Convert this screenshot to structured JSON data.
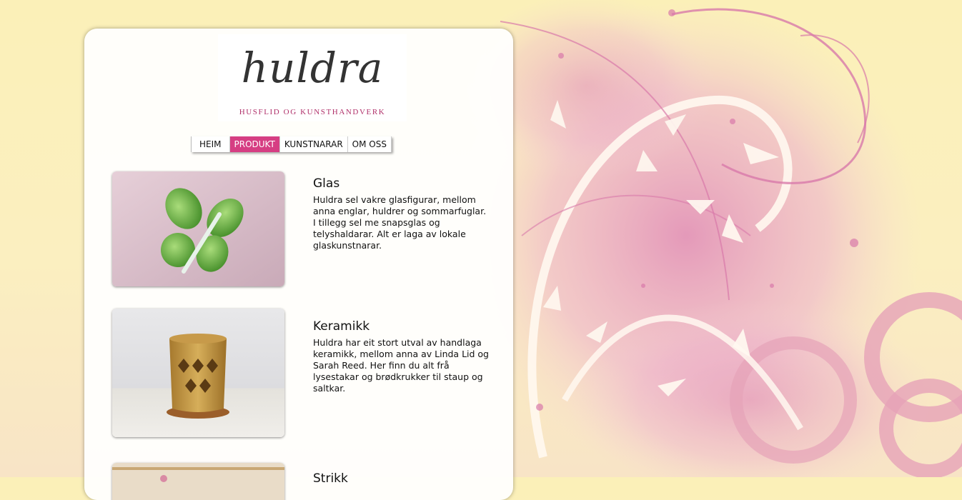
{
  "logo": {
    "name": "huldra",
    "tagline": "HUSFLID OG KUNSTHANDVERK",
    "tagline_color": "#b0306a"
  },
  "nav": {
    "items": [
      {
        "label": "HEIM",
        "active": false
      },
      {
        "label": "PRODUKT",
        "active": true
      },
      {
        "label": "KUNSTNARAR",
        "active": false
      },
      {
        "label": "OM OSS",
        "active": false
      }
    ],
    "active_color": "#d63e83"
  },
  "products": [
    {
      "title": "Glas",
      "description": "Huldra sel vakre glasfigurar, mellom anna englar, huldrer og sommarfuglar. I tillegg sel me snapsglas og telyshaldarar. Alt er laga av lokale glaskunstnarar.",
      "image": "green-glass-butterfly"
    },
    {
      "title": "Keramikk",
      "description": "Huldra har eit stort utval av handlaga keramikk, mellom anna av Linda Lid og Sarah Reed. Her finn du alt frå lysestakar og brødkrukker til staup og saltkar.",
      "image": "ceramic-lantern"
    },
    {
      "title": "Strikk",
      "description": "",
      "image": "knitwear-photo"
    }
  ],
  "colors": {
    "background": "#fbf0b8",
    "accent_pink": "#d63e83"
  }
}
